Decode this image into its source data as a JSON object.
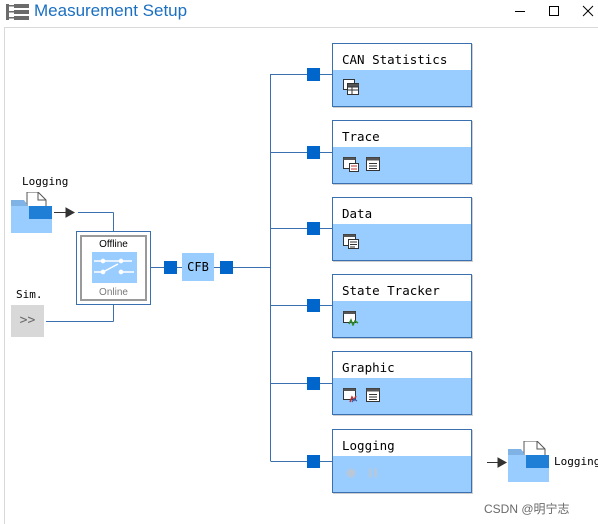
{
  "window": {
    "title": "Measurement Setup"
  },
  "source": {
    "logging_label": "Logging",
    "sim_label": "Sim.",
    "sim_button": ">>"
  },
  "switch": {
    "offline_label": "Offline",
    "online_label": "Online"
  },
  "cfb": {
    "label": "CFB"
  },
  "blocks": [
    {
      "label": "CAN Statistics",
      "icons": [
        "statistics-table-icon"
      ]
    },
    {
      "label": "Trace",
      "icons": [
        "trace-window-icon",
        "config-list-icon"
      ]
    },
    {
      "label": "Data",
      "icons": [
        "data-window-icon"
      ]
    },
    {
      "label": "State Tracker",
      "icons": [
        "state-tracker-icon"
      ]
    },
    {
      "label": "Graphic",
      "icons": [
        "graphic-window-icon",
        "config-list-icon"
      ]
    },
    {
      "label": "Logging",
      "icons": [
        "record-icon",
        "pause-icon"
      ]
    }
  ],
  "output": {
    "logging_label": "Logging"
  },
  "watermark": "CSDN @明宁志",
  "colors": {
    "accent": "#0066cc",
    "wire": "#3a6fb0",
    "block_bar": "#99ccff",
    "title": "#1b6fc1"
  }
}
